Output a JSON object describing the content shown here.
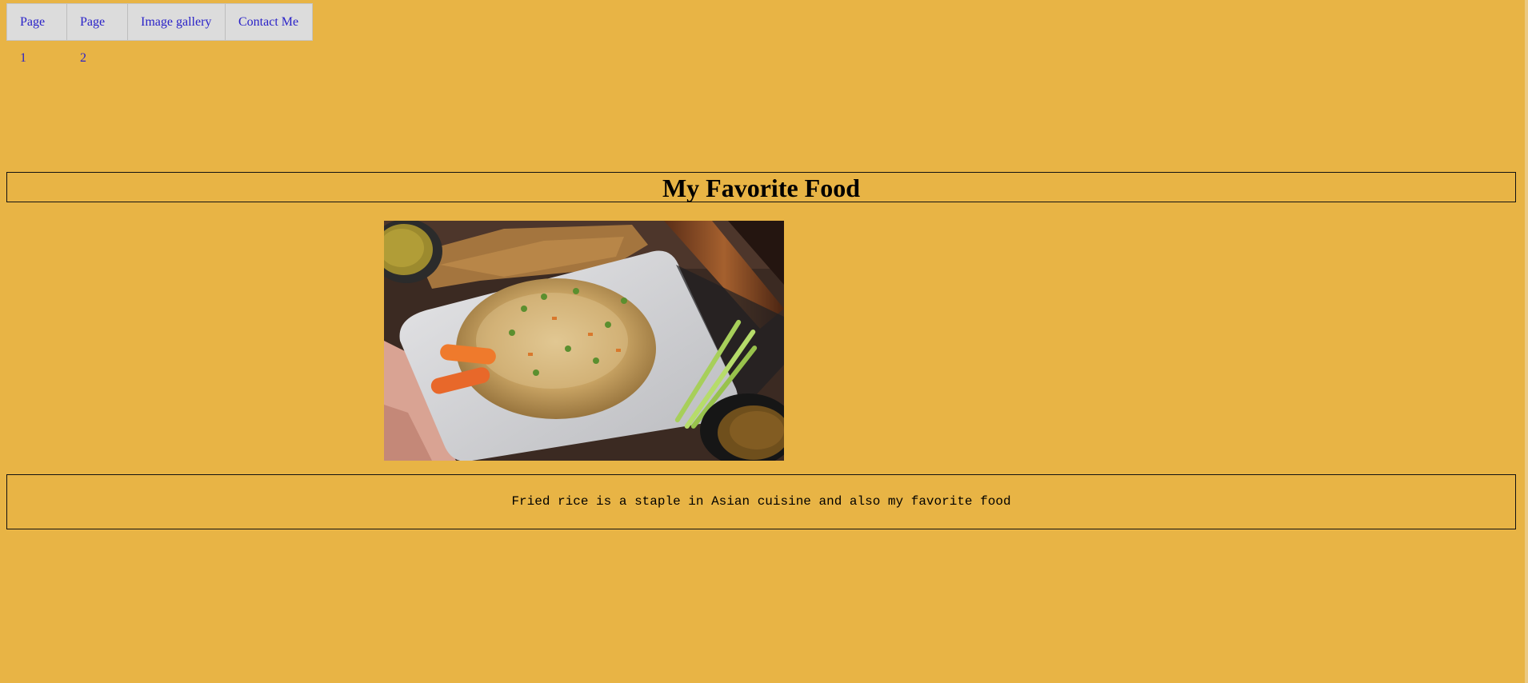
{
  "nav": {
    "items": [
      {
        "label": "Page 1"
      },
      {
        "label": "Page 2"
      },
      {
        "label": "Image gallery"
      },
      {
        "label": "Contact Me"
      }
    ]
  },
  "header": {
    "title": "My Favorite Food"
  },
  "main": {
    "image_description_icon": "food-photo",
    "caption": "Fried rice is a staple in Asian cuisine and also my favorite food"
  },
  "colors": {
    "background": "#e8b445",
    "nav_background": "#dcdcdc",
    "link": "#2a22c8",
    "border": "#111111"
  }
}
